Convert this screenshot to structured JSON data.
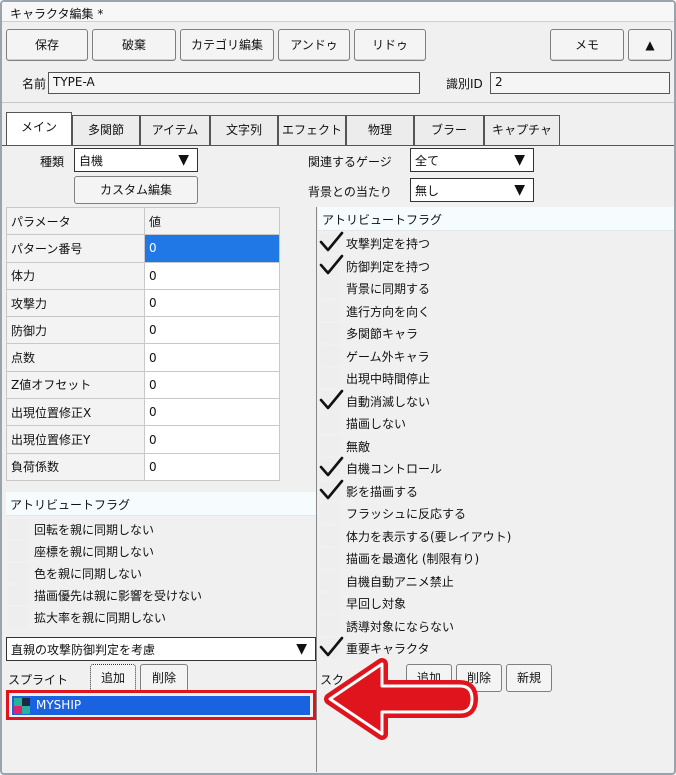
{
  "window": {
    "title": "キャラクタ編集 *"
  },
  "toolbar": {
    "save": "保存",
    "discard": "破棄",
    "category_edit": "カテゴリ編集",
    "undo": "アンドゥ",
    "redo": "リドゥ",
    "memo": "メモ",
    "up": "▲"
  },
  "identity": {
    "name_label": "名前",
    "name_value": "TYPE-A",
    "id_label": "識別ID",
    "id_value": "2"
  },
  "tabs": [
    "メイン",
    "多関節",
    "アイテム",
    "文字列",
    "エフェクト",
    "物理",
    "ブラー",
    "キャプチャ"
  ],
  "settings": {
    "type_label": "種類",
    "type_value": "自機",
    "custom_edit": "カスタム編集",
    "gauge_label": "関連するゲージ",
    "gauge_value": "全て",
    "bg_label": "背景との当たり",
    "bg_value": "無し"
  },
  "params": {
    "header_name": "パラメータ",
    "header_value": "値",
    "rows": [
      {
        "name": "パターン番号",
        "value": "0"
      },
      {
        "name": "体力",
        "value": "0"
      },
      {
        "name": "攻撃力",
        "value": "0"
      },
      {
        "name": "防御力",
        "value": "0"
      },
      {
        "name": "点数",
        "value": "0"
      },
      {
        "name": "Z値オフセット",
        "value": "0"
      },
      {
        "name": "出現位置修正X",
        "value": "0"
      },
      {
        "name": "出現位置修正Y",
        "value": "0"
      },
      {
        "name": "負荷係数",
        "value": "0"
      }
    ]
  },
  "left_flags": {
    "header": "アトリビュートフラグ",
    "items": [
      {
        "label": "回転を親に同期しない",
        "checked": false
      },
      {
        "label": "座標を親に同期しない",
        "checked": false
      },
      {
        "label": "色を親に同期しない",
        "checked": false
      },
      {
        "label": "描画優先は親に影響を受けない",
        "checked": false
      },
      {
        "label": "拡大率を親に同期しない",
        "checked": false
      }
    ]
  },
  "right_flags": {
    "header": "アトリビュートフラグ",
    "items": [
      {
        "label": "攻撃判定を持つ",
        "checked": true
      },
      {
        "label": "防御判定を持つ",
        "checked": true
      },
      {
        "label": "背景に同期する",
        "checked": false
      },
      {
        "label": "進行方向を向く",
        "checked": false
      },
      {
        "label": "多関節キャラ",
        "checked": false
      },
      {
        "label": "ゲーム外キャラ",
        "checked": false
      },
      {
        "label": "出現中時間停止",
        "checked": false
      },
      {
        "label": "自動消滅しない",
        "checked": true
      },
      {
        "label": "描画しない",
        "checked": false
      },
      {
        "label": "無敵",
        "checked": false
      },
      {
        "label": "自機コントロール",
        "checked": true
      },
      {
        "label": "影を描画する",
        "checked": true
      },
      {
        "label": "フラッシュに反応する",
        "checked": false
      },
      {
        "label": "体力を表示する(要レイアウト)",
        "checked": false
      },
      {
        "label": "描画を最適化 (制限有り)",
        "checked": false
      },
      {
        "label": "自機自動アニメ禁止",
        "checked": false
      },
      {
        "label": "早回し対象",
        "checked": false
      },
      {
        "label": "誘導対象にならない",
        "checked": false
      },
      {
        "label": "重要キャラクタ",
        "checked": true
      }
    ]
  },
  "parent_collision": {
    "value": "直親の攻撃防御判定を考慮"
  },
  "sprite": {
    "label": "スプライト",
    "add": "追加",
    "delete": "削除",
    "selected_item": "MYSHIP"
  },
  "right_sprite": {
    "label": "スク",
    "add": "追加",
    "delete": "削除",
    "new": "新規"
  },
  "colors": {
    "selection_blue": "#1a63e0",
    "highlight_red": "#e0141c"
  }
}
